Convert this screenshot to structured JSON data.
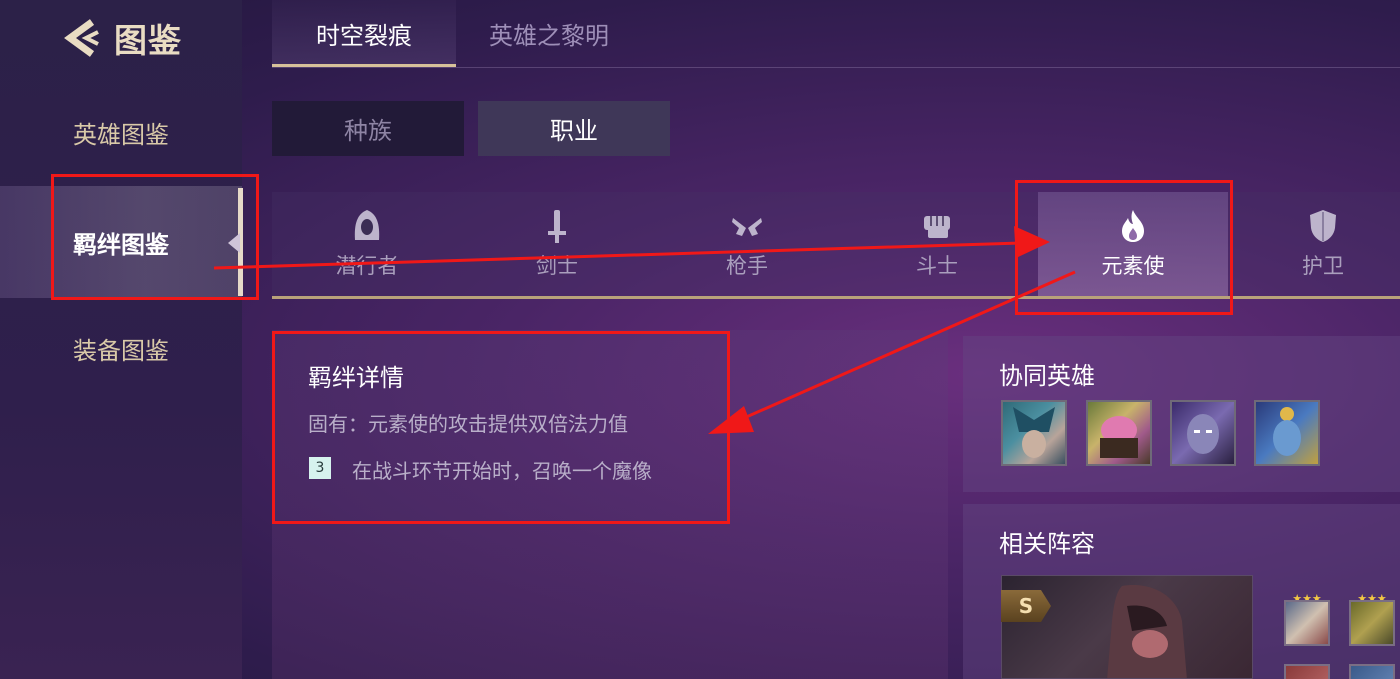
{
  "header": {
    "title": "图鉴"
  },
  "sidebar": {
    "items": [
      {
        "label": "英雄图鉴"
      },
      {
        "label": "羁绊图鉴"
      },
      {
        "label": "装备图鉴"
      }
    ]
  },
  "tabs": [
    {
      "label": "时空裂痕"
    },
    {
      "label": "英雄之黎明"
    }
  ],
  "category": {
    "race": "种族",
    "class": "职业"
  },
  "classes": [
    {
      "label": "潜行者",
      "icon": "hood-icon"
    },
    {
      "label": "剑士",
      "icon": "sword-icon"
    },
    {
      "label": "枪手",
      "icon": "guns-icon"
    },
    {
      "label": "斗士",
      "icon": "fist-icon"
    },
    {
      "label": "元素使",
      "icon": "flame-icon"
    },
    {
      "label": "护卫",
      "icon": "shield-icon"
    }
  ],
  "detail": {
    "title": "羁绊详情",
    "innate": "固有：元素使的攻击提供双倍法力值",
    "tier": "3",
    "tier_text": "在战斗环节开始时，召唤一个魔像"
  },
  "synergy": {
    "title": "协同英雄"
  },
  "lineup": {
    "title": "相关阵容",
    "grade": "S"
  },
  "colors": {
    "accent_gold": "#d7c29a",
    "annotation_red": "#f01818"
  }
}
